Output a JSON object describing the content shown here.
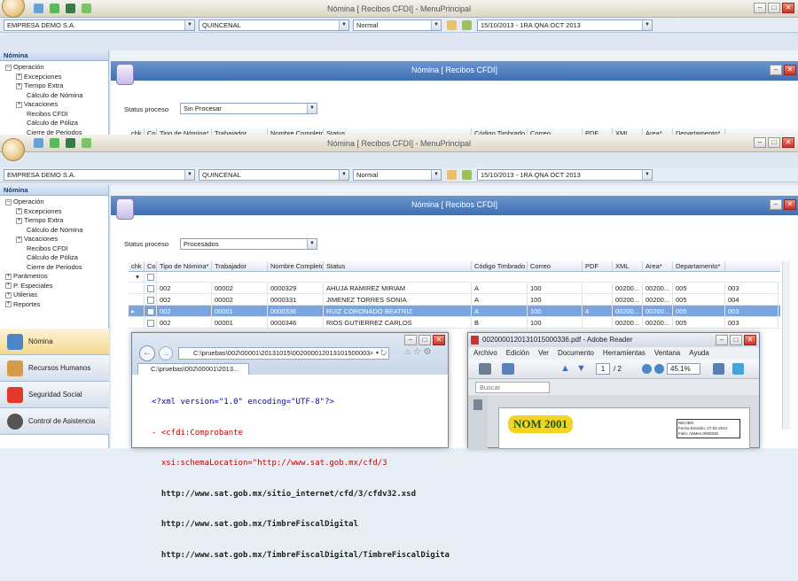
{
  "app": {
    "title": "Nómina [ Recibos CFDI] - MenuPrincipal"
  },
  "toolbar": {
    "company": "EMPRESA DEMO S.A.",
    "period_type": "QUINCENAL",
    "payroll_type": "Normal",
    "period": "15/10/2013 - 1RA QNA OCT 2013"
  },
  "sidebar": {
    "title": "Nómina",
    "tree": {
      "operacion": "Operación",
      "excepciones": "Excepciones",
      "tiempo_extra": "Tiempo Extra",
      "calculo_nomina": "Cálculo de Nómina",
      "vacaciones": "Vacaciones",
      "recibos": "Recibos CFDI",
      "calculo_poliza": "Cálculo de Póliza",
      "cierre": "Cierre de Periodos",
      "parametros": "Parámetros",
      "especiales": "P. Especiales",
      "utilerias": "Utilerias",
      "reportes": "Reportes"
    },
    "nav": {
      "nomina": "Nómina",
      "rh": "Recursos Humanos",
      "seguridad": "Seguridad Social",
      "asistencia": "Control de Asistencia"
    }
  },
  "document": {
    "title": "Nómina [ Recibos CFDI]",
    "status_label": "Status proceso",
    "status_top": "Sin Procesar",
    "status_bottom": "Procesados"
  },
  "grid": {
    "headers": [
      "chk",
      "Compañía*",
      "Tipo de Nómina*",
      "Trabajador",
      "Nombre Completo",
      "Status",
      "Código Timbrado",
      "Correo",
      "PDF",
      "XML",
      "Area*",
      "Departamento*"
    ],
    "rows": [
      {
        "compania": "002",
        "tipo": "00002",
        "trabajador": "0000329",
        "nombre": "AHUJA RAMIREZ MIRIAM",
        "status": "A",
        "codigo": "100",
        "correo": "",
        "pdf": "00200...",
        "xml": "00200...",
        "area": "005",
        "depto": "003"
      },
      {
        "compania": "002",
        "tipo": "00002",
        "trabajador": "0000331",
        "nombre": "JIMENEZ TORRES SONIA",
        "status": "A",
        "codigo": "100",
        "correo": "",
        "pdf": "00200...",
        "xml": "00200...",
        "area": "005",
        "depto": "004"
      },
      {
        "compania": "002",
        "tipo": "00001",
        "trabajador": "0000336",
        "nombre": "RUIZ CORONADO BEATRIZ",
        "status": "A",
        "codigo": "100",
        "correo": "4",
        "pdf": "00200...",
        "xml": "00200...",
        "area": "005",
        "depto": "003"
      },
      {
        "compania": "002",
        "tipo": "00001",
        "trabajador": "0000346",
        "nombre": "RIOS GUTIERREZ CARLOS",
        "status": "B",
        "codigo": "100",
        "correo": "",
        "pdf": "00200...",
        "xml": "00200...",
        "area": "005",
        "depto": "003"
      }
    ]
  },
  "browser": {
    "address": "C:\\pruebas\\002\\00001\\20131015\\002000012013101500003",
    "tab": "C:\\pruebas\\002\\00001\\2013...",
    "xml": [
      "<?xml version=\"1.0\" encoding=\"UTF-8\"?>",
      "- <cfdi:Comprobante",
      "  xsi:schemaLocation=\"http://www.sat.gob.mx/cfd/3",
      "  http://www.sat.gob.mx/sitio_internet/cfd/3/cfdv32.xsd",
      "  http://www.sat.gob.mx/TimbreFiscalDigital",
      "  http://www.sat.gob.mx/TimbreFiscalDigital/TimbreFiscalDigita"
    ]
  },
  "pdf": {
    "title": "0020000120131015000336.pdf - Adobe Reader",
    "menu": [
      "Archivo",
      "Edición",
      "Ver",
      "Documento",
      "Herramientas",
      "Ventana",
      "Ayuda"
    ],
    "page": "1",
    "pages": "/ 2",
    "zoom": "45.1%",
    "search": "Buscar",
    "logo": "NOM 2001",
    "receipt": [
      "RECIBO",
      "Fecha Emisión: 27-02-2014",
      "Folio: AbMex-0000336"
    ]
  },
  "colors": {
    "doc_header": "#4f7ec0",
    "selected_row": "#7aa5dd"
  }
}
